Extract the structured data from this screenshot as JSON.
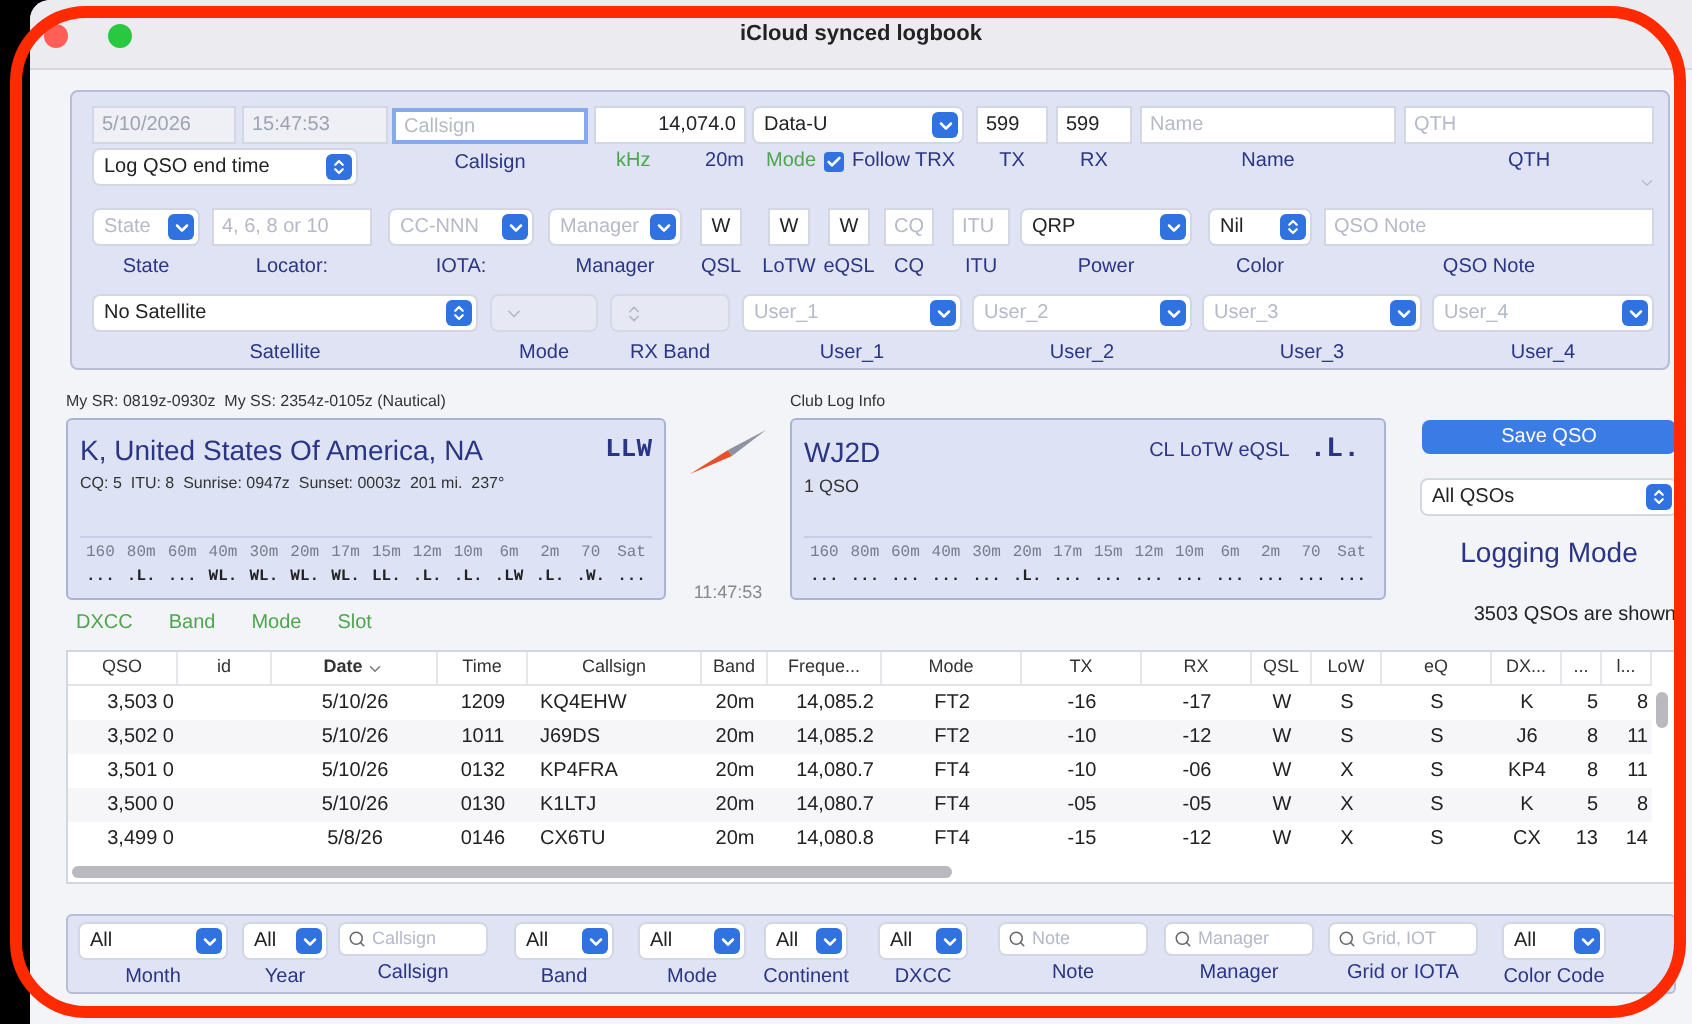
{
  "window": {
    "title": "iCloud synced logbook"
  },
  "entry": {
    "row1": {
      "date": "5/10/2026",
      "time": "15:47:53",
      "end_time": "Log QSO end time",
      "callsign": {
        "placeholder": "Callsign",
        "label": "Callsign",
        "focused": true
      },
      "frequency": {
        "value": "14,074.0",
        "unit": "kHz",
        "band": "20m"
      },
      "mode": {
        "value": "Data-U",
        "label": "Mode"
      },
      "follow_trx": {
        "label": "Follow TRX",
        "checked": true
      },
      "tx": {
        "value": "599",
        "label": "TX"
      },
      "rx": {
        "value": "599",
        "label": "RX"
      },
      "name": {
        "placeholder": "Name",
        "label": "Name"
      },
      "qth": {
        "placeholder": "QTH",
        "label": "QTH"
      }
    },
    "row2": [
      {
        "kind": "select",
        "placeholder": "State",
        "label": "State"
      },
      {
        "kind": "text",
        "placeholder": "4, 6, 8 or 10",
        "label": "Locator:"
      },
      {
        "kind": "select",
        "placeholder": "CC-NNN",
        "label": "IOTA:"
      },
      {
        "kind": "select",
        "placeholder": "Manager",
        "label": "Manager"
      },
      {
        "kind": "text",
        "value": "W",
        "label": "QSL"
      },
      {
        "kind": "text",
        "value": "W",
        "label": "LoTW"
      },
      {
        "kind": "text",
        "value": "W",
        "label": "eQSL"
      },
      {
        "kind": "text",
        "placeholder": "CQ",
        "label": "CQ"
      },
      {
        "kind": "text",
        "placeholder": "ITU",
        "label": "ITU"
      },
      {
        "kind": "select",
        "value": "QRP",
        "label": "Power"
      },
      {
        "kind": "popup",
        "value": "Nil",
        "label": "Color"
      },
      {
        "kind": "text",
        "placeholder": "QSO Note",
        "label": "QSO Note"
      }
    ],
    "row3": [
      {
        "kind": "popup",
        "value": "No Satellite",
        "label": "Satellite",
        "disabled": false
      },
      {
        "kind": "select",
        "label": "Mode",
        "disabled": true
      },
      {
        "kind": "popup",
        "label": "RX Band",
        "disabled": true
      },
      {
        "kind": "select",
        "placeholder": "User_1",
        "label": "User_1",
        "disabled": false
      },
      {
        "kind": "select",
        "placeholder": "User_2",
        "label": "User_2",
        "disabled": false
      },
      {
        "kind": "select",
        "placeholder": "User_3",
        "label": "User_3",
        "disabled": false
      },
      {
        "kind": "select",
        "placeholder": "User_4",
        "label": "User_4",
        "disabled": false
      }
    ]
  },
  "sun_times": "My SR: 0819z-0930z  My SS: 2354z-0105z (Nautical)",
  "dxcc_card": {
    "entity": "K, United States Of America, NA",
    "status": "LLW",
    "details": "CQ: 5  ITU: 8  Sunrise: 0947z  Sunset: 0003z  201 mi.  237°",
    "bands": [
      "160",
      "80m",
      "60m",
      "40m",
      "30m",
      "20m",
      "17m",
      "15m",
      "12m",
      "10m",
      "6m",
      "2m",
      "70",
      "Sat"
    ],
    "slots": [
      "...",
      ".L.",
      "...",
      "WL.",
      "WL.",
      "WL.",
      "WL.",
      "LL.",
      ".L.",
      ".L.",
      ".LW",
      ".L.",
      ".W.",
      "..."
    ]
  },
  "clock": "11:47:53",
  "links": [
    "DXCC",
    "Band",
    "Mode",
    "Slot"
  ],
  "club_log": {
    "title": "Club Log Info",
    "callsign": "WJ2D",
    "services": "CL LoTW eQSL",
    "status": ".L.",
    "count": "1 QSO",
    "bands": [
      "160",
      "80m",
      "60m",
      "40m",
      "30m",
      "20m",
      "17m",
      "15m",
      "12m",
      "10m",
      "6m",
      "2m",
      "70",
      "Sat"
    ],
    "slots": [
      "...",
      "...",
      "...",
      "...",
      "...",
      ".L.",
      "...",
      "...",
      "...",
      "...",
      "...",
      "...",
      "...",
      "..."
    ]
  },
  "save_button": "Save QSO",
  "qso_filter": "All QSOs",
  "mode_title": "Logging Mode",
  "shown_count": "3503 QSOs are shown",
  "table": {
    "columns": [
      {
        "label": "QSO",
        "sorted": false
      },
      {
        "label": "id",
        "sorted": false
      },
      {
        "label": "Date",
        "sorted": true
      },
      {
        "label": "Time",
        "sorted": false
      },
      {
        "label": "Callsign",
        "sorted": false
      },
      {
        "label": "Band",
        "sorted": false
      },
      {
        "label": "Freque...",
        "sorted": false
      },
      {
        "label": "Mode",
        "sorted": false
      },
      {
        "label": "TX",
        "sorted": false
      },
      {
        "label": "RX",
        "sorted": false
      },
      {
        "label": "QSL",
        "sorted": false
      },
      {
        "label": "LoW",
        "sorted": false
      },
      {
        "label": "eQ",
        "sorted": false
      },
      {
        "label": "DX...",
        "sorted": false
      },
      {
        "label": "...",
        "sorted": false
      },
      {
        "label": "l...",
        "sorted": false
      }
    ],
    "rows": [
      [
        "3,503 0",
        "",
        "5/10/26",
        "1209",
        "KQ4EHW",
        "20m",
        "14,085.2",
        "FT2",
        "-16",
        "-17",
        "W",
        "S",
        "S",
        "K",
        "5",
        "8"
      ],
      [
        "3,502 0",
        "",
        "5/10/26",
        "1011",
        "J69DS",
        "20m",
        "14,085.2",
        "FT2",
        "-10",
        "-12",
        "W",
        "S",
        "S",
        "J6",
        "8",
        "11"
      ],
      [
        "3,501 0",
        "",
        "5/10/26",
        "0132",
        "KP4FRA",
        "20m",
        "14,080.7",
        "FT4",
        "-10",
        "-06",
        "W",
        "X",
        "S",
        "KP4",
        "8",
        "11"
      ],
      [
        "3,500 0",
        "",
        "5/10/26",
        "0130",
        "K1LTJ",
        "20m",
        "14,080.7",
        "FT4",
        "-05",
        "-05",
        "W",
        "X",
        "S",
        "K",
        "5",
        "8"
      ],
      [
        "3,499 0",
        "",
        "5/8/26",
        "0146",
        "CX6TU",
        "20m",
        "14,080.8",
        "FT4",
        "-15",
        "-12",
        "W",
        "X",
        "S",
        "CX",
        "13",
        "14"
      ]
    ]
  },
  "filters": [
    {
      "kind": "select",
      "value": "All",
      "label": "Month"
    },
    {
      "kind": "select",
      "value": "All",
      "label": "Year"
    },
    {
      "kind": "search",
      "placeholder": "Callsign",
      "label": "Callsign"
    },
    {
      "kind": "select",
      "value": "All",
      "label": "Band"
    },
    {
      "kind": "select",
      "value": "All",
      "label": "Mode"
    },
    {
      "kind": "select",
      "value": "All",
      "label": "Continent"
    },
    {
      "kind": "select",
      "value": "All",
      "label": "DXCC"
    },
    {
      "kind": "search",
      "placeholder": "Note",
      "label": "Note"
    },
    {
      "kind": "search",
      "placeholder": "Manager",
      "label": "Manager"
    },
    {
      "kind": "search",
      "placeholder": "Grid, IOT",
      "label": "Grid or IOTA"
    },
    {
      "kind": "select",
      "value": "All",
      "label": "Color Code"
    }
  ]
}
